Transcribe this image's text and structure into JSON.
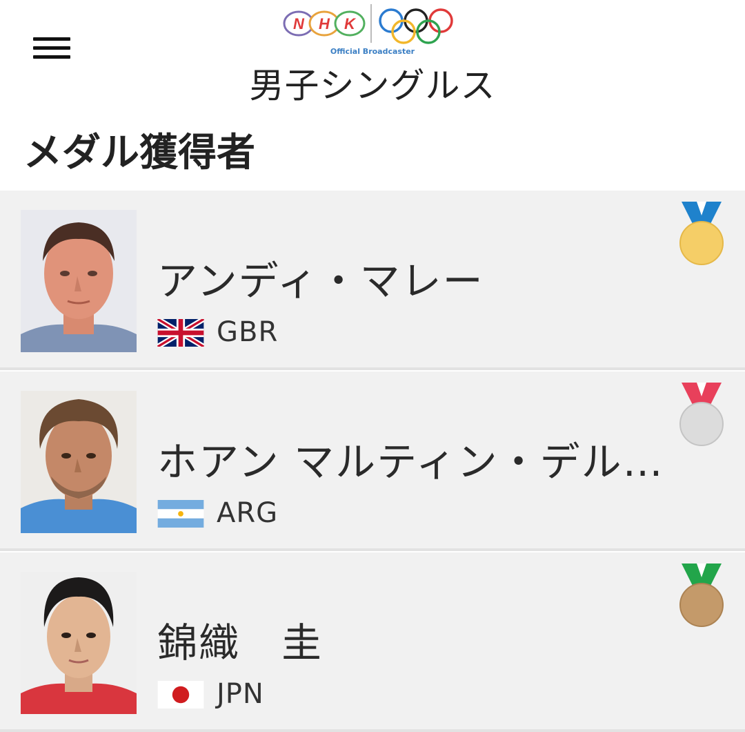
{
  "header": {
    "menu_icon": "hamburger-menu-icon",
    "logo_text": "NHK",
    "tagline": "Official Broadcaster",
    "title": "男子シングルス"
  },
  "section": {
    "title": "メダル獲得者"
  },
  "medalists": [
    {
      "name": "アンディ・マレー",
      "country": "GBR",
      "medal": "gold",
      "medal_color": "#f5ce67",
      "ribbon_color": "#1f82cc"
    },
    {
      "name": "ホアン マルティン・デル …",
      "country": "ARG",
      "medal": "silver",
      "medal_color": "#dcdcdc",
      "ribbon_color": "#e8405b"
    },
    {
      "name": "錦織　圭",
      "country": "JPN",
      "medal": "bronze",
      "medal_color": "#c49a6a",
      "ribbon_color": "#22a54a"
    }
  ]
}
